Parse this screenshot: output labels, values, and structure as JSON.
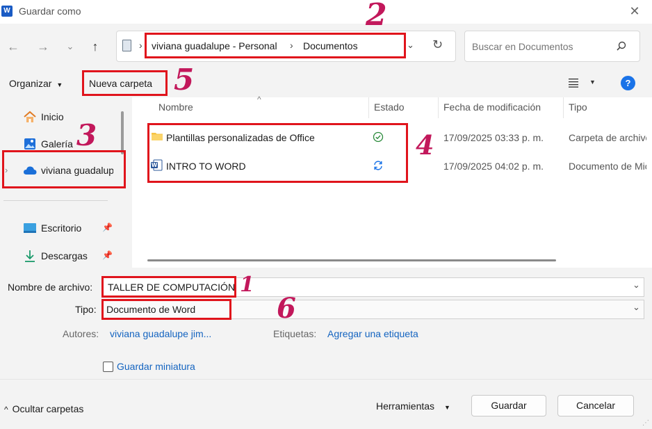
{
  "window": {
    "title": "Guardar como",
    "app_icon": "W"
  },
  "nav": {
    "breadcrumb": [
      "viviana guadalupe - Personal",
      "Documentos"
    ],
    "search_placeholder": "Buscar en Documentos"
  },
  "toolbar": {
    "organize_label": "Organizar",
    "new_folder_label": "Nueva carpeta"
  },
  "sidebar": {
    "items": [
      {
        "label": "Inicio"
      },
      {
        "label": "Galería"
      },
      {
        "label": "viviana guadalupe - Personal"
      },
      {
        "label": "Escritorio"
      },
      {
        "label": "Descargas"
      }
    ]
  },
  "columns": {
    "name": "Nombre",
    "status": "Estado",
    "modified": "Fecha de modificación",
    "type": "Tipo"
  },
  "files": [
    {
      "name": "Plantillas personalizadas de Office",
      "modified": "17/09/2025 03:33 p. m.",
      "type": "Carpeta de archivos"
    },
    {
      "name": "INTRO TO WORD",
      "modified": "17/09/2025 04:02 p. m.",
      "type": "Documento de Microsoft Word"
    }
  ],
  "form": {
    "filename_label": "Nombre de archivo:",
    "filename_value": "TALLER DE COMPUTACIÓN",
    "type_label": "Tipo:",
    "type_value": "Documento de Word",
    "authors_label": "Autores:",
    "authors_value": "viviana guadalupe jim...",
    "tags_label": "Etiquetas:",
    "tags_value": "Agregar una etiqueta",
    "thumbnail_label": "Guardar miniatura"
  },
  "footer": {
    "hide_folders_label": "Ocultar carpetas",
    "tools_label": "Herramientas",
    "save_label": "Guardar",
    "cancel_label": "Cancelar"
  },
  "annotations": [
    "1",
    "2",
    "3",
    "4",
    "5",
    "6"
  ],
  "colors": {
    "accent": "#1464c0",
    "highlight": "#e0141c",
    "annotation": "#c2185b",
    "help": "#1a73e8"
  }
}
